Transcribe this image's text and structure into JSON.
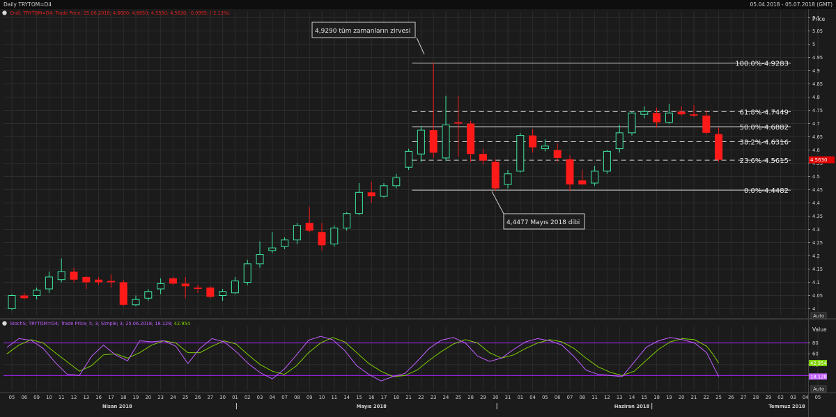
{
  "window": {
    "title": "Daily TRYTOM=D4",
    "date_range": "05.04.2018 - 05.07.2018 (GMT)"
  },
  "price_panel": {
    "legend": "Cndl; TRYTOM=D4; Trade Price; 25.06.2018; 4.6600; 4.6850; 4.5550; 4.5630; -0.0995; (-2.13%)",
    "axis_title": "Price",
    "auto_label": "Auto",
    "last_price": "4.5630",
    "last_price_color": "#e00000"
  },
  "stoch_panel": {
    "legend_prefix": "StochS; TRYTOM=D4; Trade Price;  5; 3; Simple; 3; 25.06.2018; ",
    "legend_k": "18.128",
    "legend_k_color": "#c060ff",
    "legend_sep": "; ",
    "legend_d": "42.954",
    "legend_d_color": "#7fd000",
    "axis_title": "Value",
    "auto_label": "Auto",
    "badge_d": "42.954",
    "badge_k": "18.128"
  },
  "annotations": {
    "top": "4,9290 tüm zamanların zirvesi",
    "bottom": "4,4477 Mayıs 2018 dibi"
  },
  "fib_labels": [
    "100.0%-4.9283",
    "61.8%-4.7449",
    "50.0%-4.6882",
    "38.2%-4.6316",
    "23.6%-4.5615",
    "0.0%-4.4482"
  ],
  "month_labels": [
    "Nisan 2018",
    "Mayıs 2018",
    "Haziran 2018",
    "Temmuz 2018"
  ],
  "colors": {
    "up": "#3ee6a0",
    "down": "#ff1a1a",
    "stoch_k": "#c060ff",
    "stoch_d": "#7fd000",
    "level": "#a020f0",
    "grid": "#2c2c2c",
    "fib": "#d0d0d0"
  },
  "chart_data": {
    "type": "candlestick",
    "ylim": [
      3.975,
      5.125
    ],
    "yticks": [
      "4",
      "4.05",
      "4.1",
      "4.15",
      "4.2",
      "4.25",
      "4.3",
      "4.35",
      "4.4",
      "4.45",
      "4.5",
      "4.55",
      "4.6",
      "4.65",
      "4.7",
      "4.75",
      "4.8",
      "4.85",
      "4.9",
      "4.95",
      "5",
      "5.05",
      "5.1"
    ],
    "x_labels": [
      "05",
      "06",
      "09",
      "10",
      "11",
      "12",
      "13",
      "16",
      "17",
      "18",
      "19",
      "20",
      "23",
      "24",
      "25",
      "26",
      "27",
      "30",
      "01",
      "02",
      "03",
      "04",
      "07",
      "08",
      "09",
      "10",
      "11",
      "14",
      "15",
      "16",
      "17",
      "18",
      "21",
      "22",
      "23",
      "24",
      "25",
      "28",
      "29",
      "30",
      "31",
      "01",
      "04",
      "05",
      "06",
      "07",
      "08",
      "11",
      "12",
      "13",
      "14",
      "15",
      "18",
      "19",
      "20",
      "21",
      "22",
      "25",
      "26",
      "27",
      "28",
      "29",
      "02",
      "03",
      "04",
      "05"
    ],
    "candles": [
      {
        "o": 4.0,
        "h": 4.055,
        "l": 3.995,
        "c": 4.05
      },
      {
        "o": 4.05,
        "h": 4.06,
        "l": 4.035,
        "c": 4.04
      },
      {
        "o": 4.05,
        "h": 4.08,
        "l": 4.035,
        "c": 4.07
      },
      {
        "o": 4.075,
        "h": 4.14,
        "l": 4.06,
        "c": 4.12
      },
      {
        "o": 4.11,
        "h": 4.19,
        "l": 4.1,
        "c": 4.14
      },
      {
        "o": 4.14,
        "h": 4.155,
        "l": 4.1,
        "c": 4.11
      },
      {
        "o": 4.12,
        "h": 4.125,
        "l": 4.075,
        "c": 4.1
      },
      {
        "o": 4.11,
        "h": 4.12,
        "l": 4.09,
        "c": 4.1
      },
      {
        "o": 4.105,
        "h": 4.13,
        "l": 4.08,
        "c": 4.1
      },
      {
        "o": 4.1,
        "h": 4.11,
        "l": 4.01,
        "c": 4.015
      },
      {
        "o": 4.015,
        "h": 4.05,
        "l": 4.01,
        "c": 4.035
      },
      {
        "o": 4.04,
        "h": 4.075,
        "l": 4.03,
        "c": 4.065
      },
      {
        "o": 4.075,
        "h": 4.115,
        "l": 4.055,
        "c": 4.095
      },
      {
        "o": 4.115,
        "h": 4.12,
        "l": 4.09,
        "c": 4.095
      },
      {
        "o": 4.095,
        "h": 4.12,
        "l": 4.04,
        "c": 4.085
      },
      {
        "o": 4.08,
        "h": 4.09,
        "l": 4.06,
        "c": 4.075
      },
      {
        "o": 4.08,
        "h": 4.085,
        "l": 4.04,
        "c": 4.045
      },
      {
        "o": 4.05,
        "h": 4.075,
        "l": 4.03,
        "c": 4.065
      },
      {
        "o": 4.06,
        "h": 4.12,
        "l": 4.055,
        "c": 4.105
      },
      {
        "o": 4.1,
        "h": 4.185,
        "l": 4.09,
        "c": 4.17
      },
      {
        "o": 4.17,
        "h": 4.255,
        "l": 4.155,
        "c": 4.205
      },
      {
        "o": 4.22,
        "h": 4.29,
        "l": 4.21,
        "c": 4.23
      },
      {
        "o": 4.235,
        "h": 4.27,
        "l": 4.225,
        "c": 4.26
      },
      {
        "o": 4.26,
        "h": 4.325,
        "l": 4.245,
        "c": 4.315
      },
      {
        "o": 4.325,
        "h": 4.385,
        "l": 4.29,
        "c": 4.295
      },
      {
        "o": 4.29,
        "h": 4.325,
        "l": 4.22,
        "c": 4.24
      },
      {
        "o": 4.245,
        "h": 4.315,
        "l": 4.235,
        "c": 4.305
      },
      {
        "o": 4.305,
        "h": 4.365,
        "l": 4.295,
        "c": 4.36
      },
      {
        "o": 4.36,
        "h": 4.475,
        "l": 4.355,
        "c": 4.44
      },
      {
        "o": 4.44,
        "h": 4.48,
        "l": 4.4,
        "c": 4.425
      },
      {
        "o": 4.425,
        "h": 4.475,
        "l": 4.42,
        "c": 4.465
      },
      {
        "o": 4.465,
        "h": 4.51,
        "l": 4.455,
        "c": 4.495
      },
      {
        "o": 4.535,
        "h": 4.605,
        "l": 4.525,
        "c": 4.595
      },
      {
        "o": 4.585,
        "h": 4.69,
        "l": 4.555,
        "c": 4.675
      },
      {
        "o": 4.675,
        "h": 4.93,
        "l": 4.57,
        "c": 4.59
      },
      {
        "o": 4.57,
        "h": 4.805,
        "l": 4.56,
        "c": 4.695
      },
      {
        "o": 4.705,
        "h": 4.805,
        "l": 4.575,
        "c": 4.7
      },
      {
        "o": 4.7,
        "h": 4.71,
        "l": 4.555,
        "c": 4.585
      },
      {
        "o": 4.585,
        "h": 4.605,
        "l": 4.545,
        "c": 4.56
      },
      {
        "o": 4.555,
        "h": 4.565,
        "l": 4.445,
        "c": 4.455
      },
      {
        "o": 4.47,
        "h": 4.525,
        "l": 4.455,
        "c": 4.51
      },
      {
        "o": 4.52,
        "h": 4.665,
        "l": 4.515,
        "c": 4.655
      },
      {
        "o": 4.655,
        "h": 4.68,
        "l": 4.59,
        "c": 4.61
      },
      {
        "o": 4.605,
        "h": 4.64,
        "l": 4.595,
        "c": 4.615
      },
      {
        "o": 4.6,
        "h": 4.625,
        "l": 4.555,
        "c": 4.57
      },
      {
        "o": 4.565,
        "h": 4.58,
        "l": 4.445,
        "c": 4.47
      },
      {
        "o": 4.485,
        "h": 4.525,
        "l": 4.475,
        "c": 4.47
      },
      {
        "o": 4.475,
        "h": 4.54,
        "l": 4.465,
        "c": 4.52
      },
      {
        "o": 4.52,
        "h": 4.6,
        "l": 4.51,
        "c": 4.595
      },
      {
        "o": 4.605,
        "h": 4.695,
        "l": 4.59,
        "c": 4.665
      },
      {
        "o": 4.665,
        "h": 4.745,
        "l": 4.655,
        "c": 4.74
      },
      {
        "o": 4.735,
        "h": 4.765,
        "l": 4.72,
        "c": 4.745
      },
      {
        "o": 4.74,
        "h": 4.76,
        "l": 4.685,
        "c": 4.705
      },
      {
        "o": 4.705,
        "h": 4.775,
        "l": 4.7,
        "c": 4.74
      },
      {
        "o": 4.745,
        "h": 4.765,
        "l": 4.73,
        "c": 4.735
      },
      {
        "o": 4.735,
        "h": 4.77,
        "l": 4.725,
        "c": 4.73
      },
      {
        "o": 4.73,
        "h": 4.75,
        "l": 4.66,
        "c": 4.665
      },
      {
        "o": 4.66,
        "h": 4.685,
        "l": 4.555,
        "c": 4.563
      }
    ],
    "fib_levels": [
      {
        "pct": "100.0%",
        "value": 4.9283,
        "dashed": false
      },
      {
        "pct": "61.8%",
        "value": 4.7449,
        "dashed": true
      },
      {
        "pct": "50.0%",
        "value": 4.6882,
        "dashed": false
      },
      {
        "pct": "38.2%",
        "value": 4.6316,
        "dashed": true
      },
      {
        "pct": "23.6%",
        "value": 4.5615,
        "dashed": true
      },
      {
        "pct": "0.0%",
        "value": 4.4482,
        "dashed": false
      }
    ],
    "fib_start_index": 32,
    "stoch": {
      "ylim": [
        0,
        100
      ],
      "yticks": [
        80,
        60,
        40,
        20
      ],
      "levels": [
        80,
        20
      ],
      "k_points": [
        [
          0,
          72
        ],
        [
          2,
          88
        ],
        [
          4,
          85
        ],
        [
          6,
          70
        ],
        [
          8,
          44
        ],
        [
          10,
          22
        ],
        [
          12,
          20
        ],
        [
          14,
          55
        ],
        [
          16,
          76
        ],
        [
          18,
          58
        ],
        [
          20,
          47
        ],
        [
          22,
          84
        ],
        [
          24,
          82
        ],
        [
          26,
          84
        ],
        [
          28,
          74
        ],
        [
          30,
          42
        ],
        [
          32,
          70
        ],
        [
          34,
          88
        ],
        [
          36,
          82
        ],
        [
          38,
          64
        ],
        [
          40,
          42
        ],
        [
          42,
          25
        ],
        [
          44,
          14
        ],
        [
          46,
          32
        ],
        [
          48,
          58
        ],
        [
          50,
          85
        ],
        [
          52,
          92
        ],
        [
          54,
          86
        ],
        [
          56,
          66
        ],
        [
          58,
          38
        ],
        [
          60,
          22
        ],
        [
          62,
          10
        ],
        [
          64,
          18
        ],
        [
          66,
          24
        ],
        [
          68,
          46
        ],
        [
          70,
          70
        ],
        [
          72,
          85
        ],
        [
          74,
          90
        ],
        [
          76,
          80
        ],
        [
          78,
          56
        ],
        [
          80,
          46
        ],
        [
          82,
          52
        ],
        [
          84,
          68
        ],
        [
          86,
          82
        ],
        [
          88,
          88
        ],
        [
          90,
          84
        ],
        [
          92,
          76
        ],
        [
          94,
          55
        ],
        [
          96,
          30
        ],
        [
          98,
          22
        ],
        [
          100,
          20
        ],
        [
          102,
          18
        ],
        [
          104,
          45
        ],
        [
          106,
          72
        ],
        [
          108,
          84
        ],
        [
          110,
          90
        ],
        [
          112,
          86
        ],
        [
          114,
          80
        ],
        [
          116,
          62
        ],
        [
          117,
          40
        ],
        [
          118,
          18.128
        ]
      ],
      "d_points": [
        [
          0,
          60
        ],
        [
          2,
          76
        ],
        [
          4,
          86
        ],
        [
          6,
          80
        ],
        [
          8,
          62
        ],
        [
          10,
          45
        ],
        [
          12,
          28
        ],
        [
          14,
          38
        ],
        [
          16,
          58
        ],
        [
          18,
          60
        ],
        [
          20,
          52
        ],
        [
          22,
          62
        ],
        [
          24,
          76
        ],
        [
          26,
          84
        ],
        [
          28,
          80
        ],
        [
          30,
          62
        ],
        [
          32,
          62
        ],
        [
          34,
          74
        ],
        [
          36,
          84
        ],
        [
          38,
          78
        ],
        [
          40,
          58
        ],
        [
          42,
          40
        ],
        [
          44,
          28
        ],
        [
          46,
          22
        ],
        [
          48,
          38
        ],
        [
          50,
          62
        ],
        [
          52,
          80
        ],
        [
          54,
          90
        ],
        [
          56,
          82
        ],
        [
          58,
          62
        ],
        [
          60,
          42
        ],
        [
          62,
          28
        ],
        [
          64,
          18
        ],
        [
          66,
          20
        ],
        [
          68,
          30
        ],
        [
          70,
          48
        ],
        [
          72,
          64
        ],
        [
          74,
          78
        ],
        [
          76,
          86
        ],
        [
          78,
          80
        ],
        [
          80,
          62
        ],
        [
          82,
          52
        ],
        [
          84,
          58
        ],
        [
          86,
          70
        ],
        [
          88,
          80
        ],
        [
          90,
          86
        ],
        [
          92,
          82
        ],
        [
          94,
          70
        ],
        [
          96,
          52
        ],
        [
          98,
          36
        ],
        [
          100,
          26
        ],
        [
          102,
          20
        ],
        [
          104,
          28
        ],
        [
          106,
          48
        ],
        [
          108,
          68
        ],
        [
          110,
          82
        ],
        [
          112,
          88
        ],
        [
          114,
          86
        ],
        [
          116,
          74
        ],
        [
          117,
          60
        ],
        [
          118,
          42.954
        ]
      ]
    }
  }
}
